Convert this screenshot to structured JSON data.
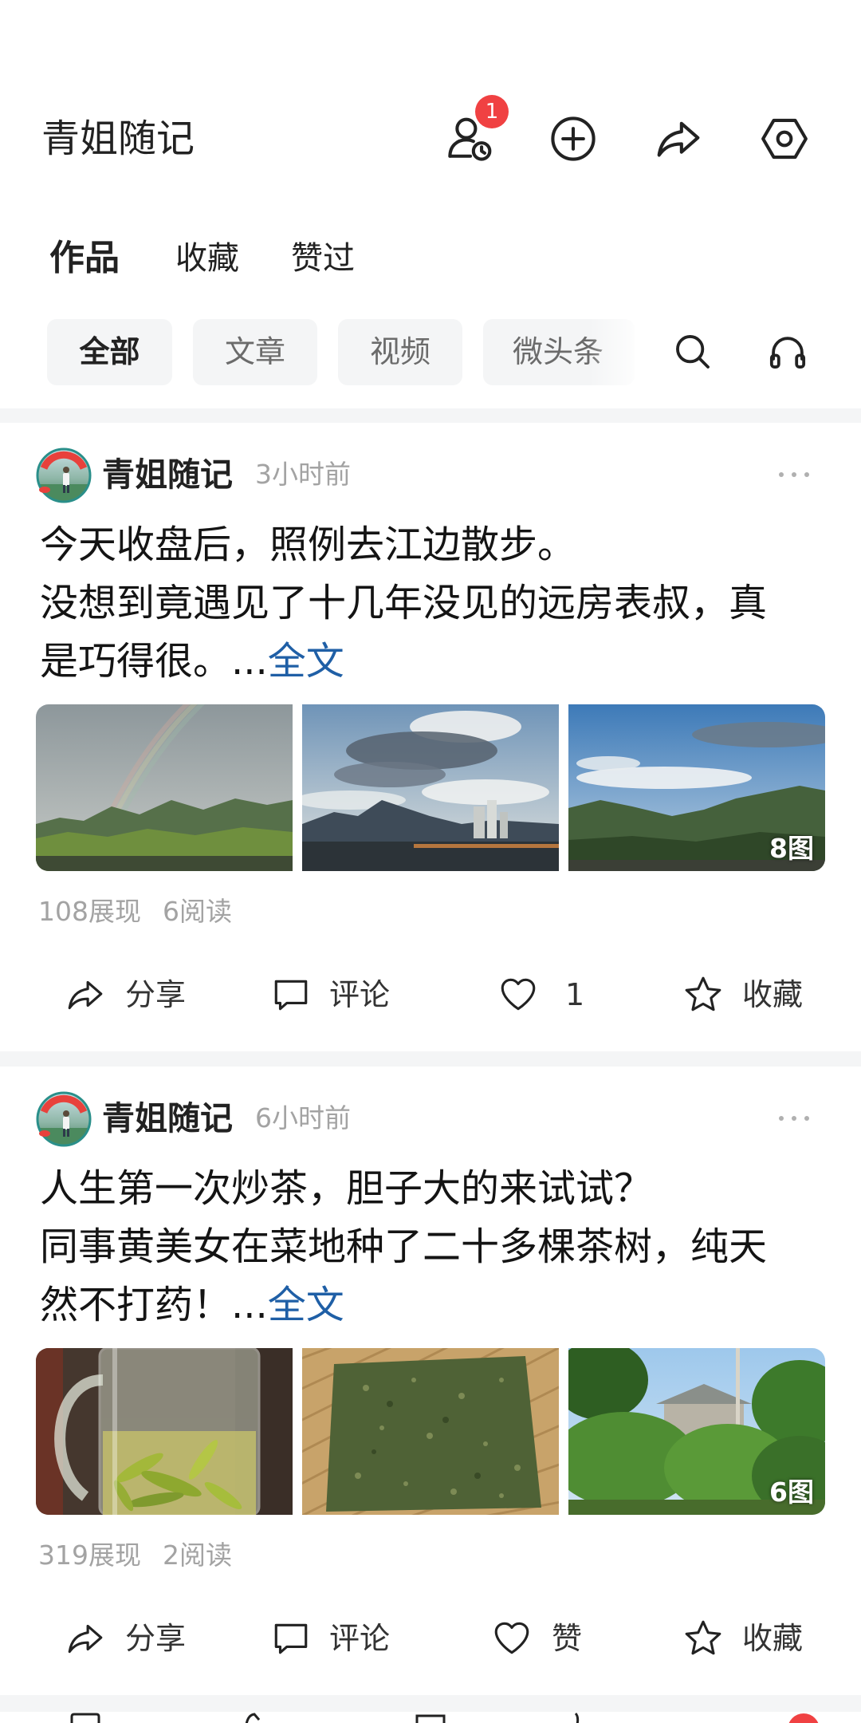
{
  "header": {
    "title": "青姐随记",
    "badge_count": "1",
    "icons": [
      "user-clock-icon",
      "plus-circle-icon",
      "share-icon",
      "settings-icon"
    ]
  },
  "tabs": [
    {
      "label": "作品",
      "active": true
    },
    {
      "label": "收藏",
      "active": false
    },
    {
      "label": "赞过",
      "active": false
    }
  ],
  "filters": [
    {
      "label": "全部",
      "active": true
    },
    {
      "label": "文章",
      "active": false
    },
    {
      "label": "视频",
      "active": false
    },
    {
      "label": "微头条",
      "active": false
    }
  ],
  "toolbar_icons": [
    "search-icon",
    "headphones-icon"
  ],
  "posts": [
    {
      "author": "青姐随记",
      "time": "3小时前",
      "lines": [
        "今天收盘后，照例去江边散步。",
        "没想到竟遇见了十几年没见的远房表叔，真",
        "是巧得很。"
      ],
      "ellipsis": "...",
      "more_link": "全文",
      "image_count": "8图",
      "stats": {
        "views": "108展现",
        "reads": "6阅读"
      },
      "actions": {
        "share": "分享",
        "comment": "评论",
        "like": "1",
        "favorite": "收藏"
      }
    },
    {
      "author": "青姐随记",
      "time": "6小时前",
      "lines": [
        "人生第一次炒茶，胆子大的来试试？",
        "同事黄美女在菜地种了二十多棵茶树，纯天",
        "然不打药！"
      ],
      "ellipsis": "...",
      "more_link": "全文",
      "image_count": "6图",
      "stats": {
        "views": "319展现",
        "reads": "2阅读"
      },
      "actions": {
        "share": "分享",
        "comment": "评论",
        "like": "赞",
        "favorite": "收藏"
      }
    }
  ],
  "colors": {
    "text": "#222222",
    "muted": "#a3a3a3",
    "link": "#1f5fa6",
    "badge": "#f04142",
    "chip_bg": "#f4f5f6",
    "separator": "#f4f5f6"
  }
}
